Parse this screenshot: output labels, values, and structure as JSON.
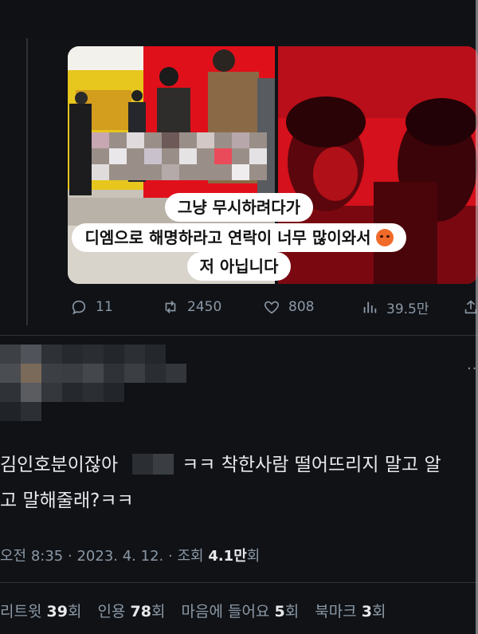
{
  "media": {
    "caption_line1": "그냥 무시하려다가",
    "caption_line2": "디엠으로 해명하라고 연락이 너무 많이와서",
    "caption_line3": "저 아닙니다",
    "caption_emoji": "angry-face-emoji"
  },
  "actions": {
    "replies": "11",
    "retweets": "2450",
    "likes": "808",
    "views": "39.5만"
  },
  "reply": {
    "line1_before": "김인호분이잖아",
    "line1_after": "ㅋㅋ 착한사람 떨어뜨리지 말고 알",
    "line2": "고 말해줄래?ㅋㅋ"
  },
  "meta": {
    "time": "오전 8:35",
    "sep": "·",
    "date": "2023. 4. 12.",
    "views_label": "조회",
    "views_value": "4.1만",
    "views_unit": "회"
  },
  "stats": {
    "retweet_label": "리트윗",
    "retweet_value": "39",
    "quote_label": "인용",
    "quote_value": "78",
    "like_label": "마음에 들어요",
    "like_value": "5",
    "bookmark_label": "북마크",
    "bookmark_value": "3",
    "unit": "회"
  },
  "colors": {
    "background": "#101216",
    "text": "#e7e9ea",
    "muted": "#8b98a5",
    "photo_red": "#d4111c"
  }
}
